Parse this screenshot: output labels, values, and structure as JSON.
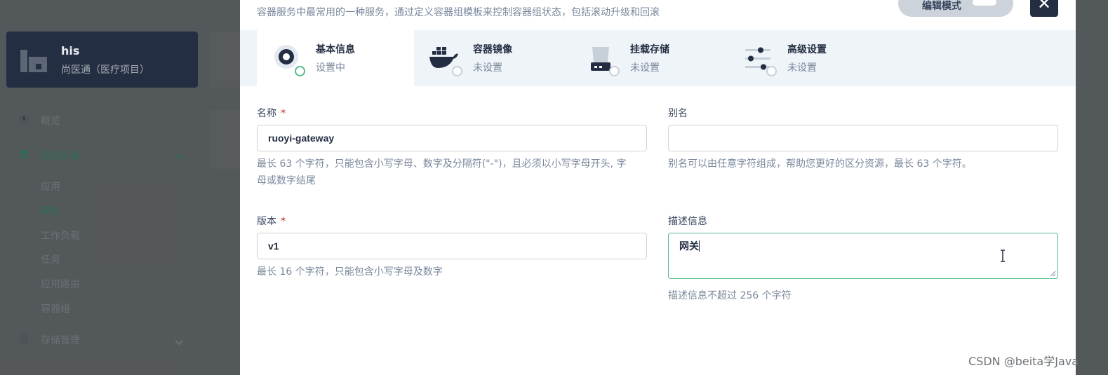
{
  "workspace": {
    "name": "his",
    "description": "尚医通（医疗项目）"
  },
  "sidebar": {
    "overview": "概览",
    "app_workloads": "应用负载",
    "sub_items": [
      "应用",
      "服务",
      "工作负载",
      "任务",
      "应用路由",
      "容器组"
    ],
    "storage": "存储管理"
  },
  "modal": {
    "description": "容器服务中最常用的一种服务，通过定义容器组模板来控制容器组状态，包括滚动升级和回滚",
    "edit_mode_label": "编辑模式",
    "close_glyph": "✕",
    "tabs": [
      {
        "title": "基本信息",
        "status": "设置中",
        "icon": "basic-info-icon"
      },
      {
        "title": "容器镜像",
        "status": "未设置",
        "icon": "docker-icon"
      },
      {
        "title": "挂载存储",
        "status": "未设置",
        "icon": "storage-icon"
      },
      {
        "title": "高级设置",
        "status": "未设置",
        "icon": "sliders-icon"
      }
    ]
  },
  "form": {
    "name": {
      "label": "名称",
      "required": "*",
      "value": "ruoyi-gateway",
      "help_line1": "最长 63 个字符，只能包含小写字母、数字及分隔符(\"-\")，且必须以小写字母开头, 字",
      "help_line2": "母或数字结尾"
    },
    "alias": {
      "label": "别名",
      "value": "",
      "help": "别名可以由任意字符组成，帮助您更好的区分资源，最长 63 个字符。"
    },
    "version": {
      "label": "版本",
      "required": "*",
      "value": "v1",
      "help": "最长 16 个字符，只能包含小写字母及数字"
    },
    "description": {
      "label": "描述信息",
      "value": "网关",
      "help": "描述信息不超过 256 个字符"
    }
  },
  "watermark": "CSDN @beita学Java",
  "colors": {
    "accent": "#55bc8a",
    "dark": "#242e42",
    "required": "#ca2621"
  }
}
